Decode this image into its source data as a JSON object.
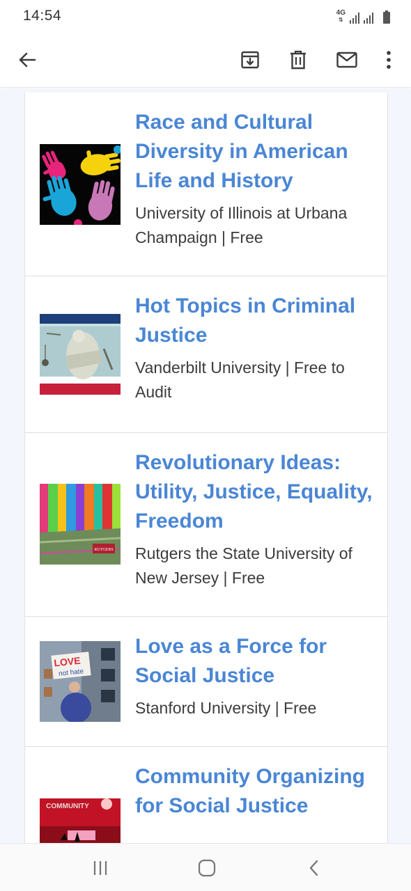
{
  "status_bar": {
    "time": "14:54",
    "network": "4G"
  },
  "toolbar": {
    "back_icon": "arrow-left-icon",
    "archive_icon": "archive-icon",
    "delete_icon": "trash-icon",
    "mark_unread_icon": "mail-icon",
    "more_icon": "more-vert-icon"
  },
  "courses": [
    {
      "title": "Race and Cultural Diversity in American Life and History",
      "meta": "University of Illinois at Urbana Champaign | Free",
      "thumb": "colorful-hands-image"
    },
    {
      "title": "Hot Topics in Criminal Justice",
      "meta": "Vanderbilt University | Free to Audit",
      "thumb": "lady-justice-statue-image"
    },
    {
      "title": "Revolutionary Ideas: Utility, Justice, Equality, Freedom",
      "meta": "Rutgers the State University of New Jersey | Free",
      "thumb": "stained-glass-hall-image",
      "thumb_badge": "RUTGERS"
    },
    {
      "title": "Love as a Force for Social Justice",
      "meta": "Stanford University | Free",
      "thumb": "love-not-hate-sign-image",
      "thumb_sign_line1": "LOVE",
      "thumb_sign_line2": "not hate"
    },
    {
      "title": "Community Organizing for Social Justice",
      "meta": "",
      "thumb": "community-stage-image",
      "thumb_badge": "COMMUNITY"
    }
  ],
  "nav_bar": {
    "recents_icon": "recent-apps-icon",
    "home_icon": "home-icon",
    "back_icon": "back-chevron-icon"
  },
  "colors": {
    "link": "#4a86d4",
    "meta_text": "#3c3c3c",
    "page_bg": "#f3f6fc"
  }
}
